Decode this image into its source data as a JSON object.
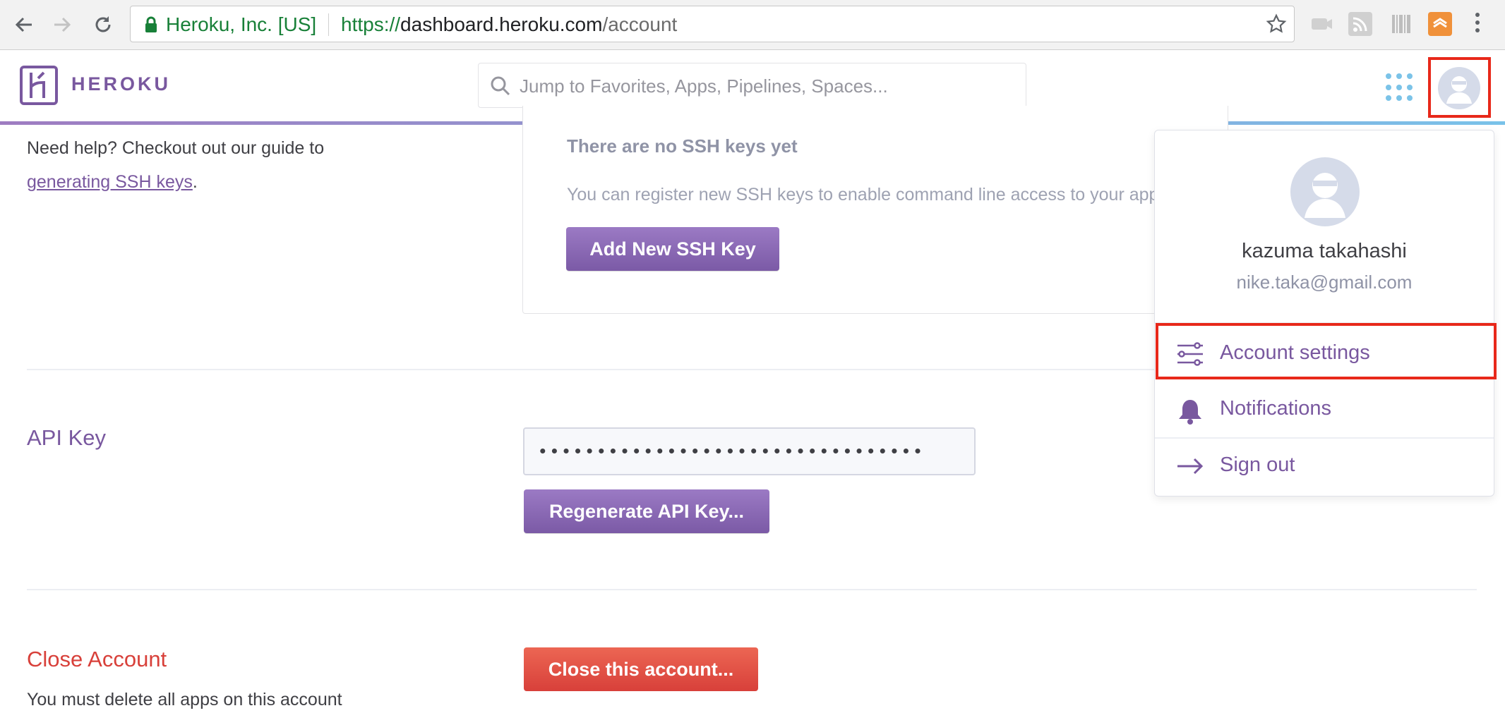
{
  "browser": {
    "secure_label": "Heroku, Inc. [US]",
    "url_scheme": "https://",
    "url_host": "dashboard.heroku.com",
    "url_path": "/account",
    "icons": [
      "back-icon",
      "forward-icon",
      "reload-icon",
      "lock-icon",
      "bookmark-star-icon",
      "extension-icons",
      "menu-kebab-icon"
    ]
  },
  "header": {
    "brand": "HEROKU",
    "search_placeholder": "Jump to Favorites, Apps, Pipelines, Spaces...",
    "brand_color": "#79589f"
  },
  "ssh": {
    "help_text": "Need help? Checkout out our guide to",
    "help_link": "generating SSH keys",
    "help_period": ".",
    "empty_title": "There are no SSH keys yet",
    "empty_desc": "You can register new SSH keys to enable command line access to your apps",
    "add_button": "Add New SSH Key"
  },
  "api": {
    "title": "API Key",
    "masked_value": "•••••••••••••••••••••••••••••••••",
    "regenerate_button": "Regenerate API Key..."
  },
  "close": {
    "title": "Close Account",
    "button": "Close this account...",
    "description": "You must delete all apps on this account",
    "title_color": "#d8403a"
  },
  "user_menu": {
    "name": "kazuma takahashi",
    "email": "nike.taka@gmail.com",
    "items": [
      {
        "label": "Account settings",
        "icon": "settings-sliders-icon"
      },
      {
        "label": "Notifications",
        "icon": "bell-icon"
      },
      {
        "label": "Sign out",
        "icon": "arrow-right-icon"
      }
    ]
  },
  "annotation_color": "#e8281a"
}
